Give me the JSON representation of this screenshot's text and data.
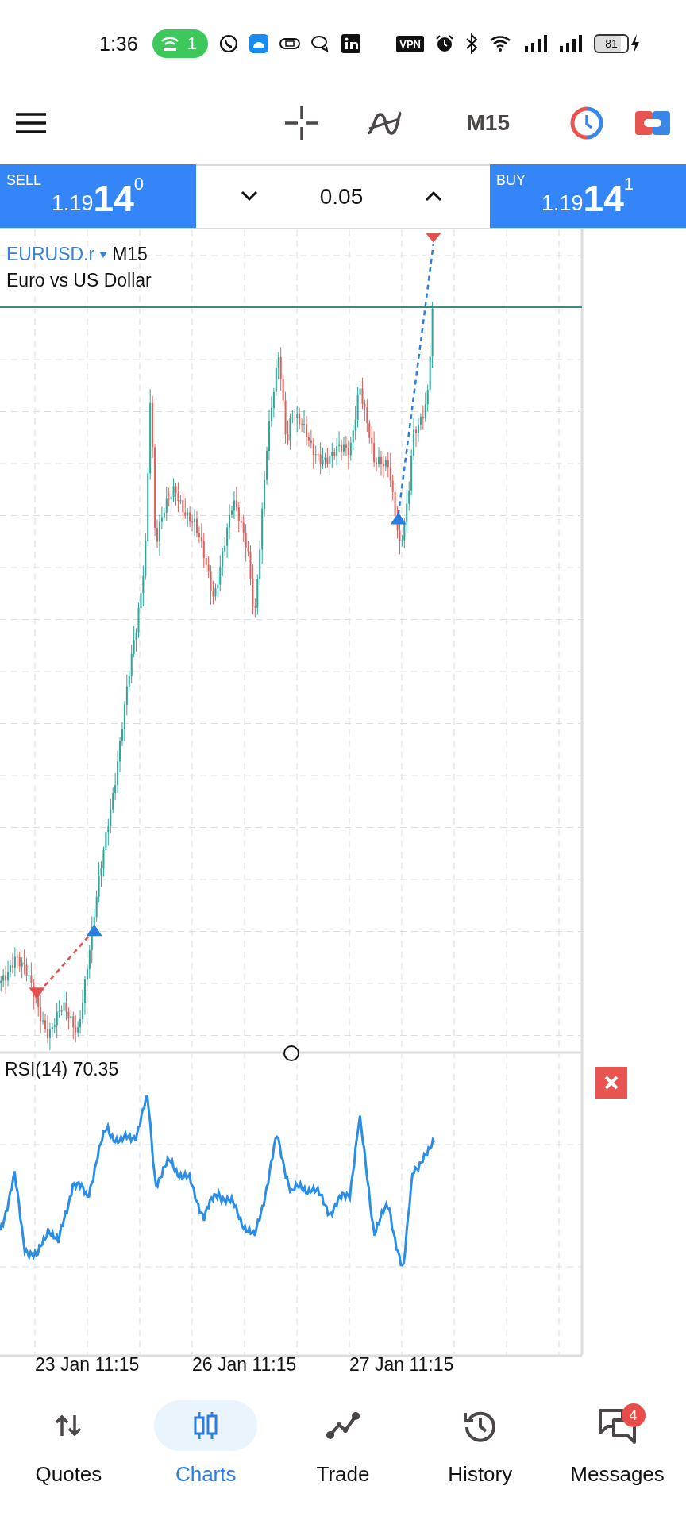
{
  "status_bar": {
    "time": "1:36",
    "hotspot_count": "1",
    "vpn_label": "VPN",
    "battery": "81"
  },
  "toolbar": {
    "timeframe": "M15"
  },
  "trade_panel": {
    "sell": {
      "label": "SELL",
      "price_small": "1.19",
      "price_big": "14",
      "price_sup": "0"
    },
    "volume": "0.05",
    "buy": {
      "label": "BUY",
      "price_small": "1.19",
      "price_big": "14",
      "price_sup": "1"
    }
  },
  "chart": {
    "symbol": "EURUSD.r",
    "timeframe": "M15",
    "description": "Euro vs US Dollar",
    "kind": "picture"
  },
  "indicator": {
    "label": "RSI(14) 70.35"
  },
  "time_axis": [
    "23 Jan 11:15",
    "26 Jan 11:15",
    "27 Jan 11:15"
  ],
  "nav": [
    {
      "label": "Quotes",
      "selected": false
    },
    {
      "label": "Charts",
      "selected": true
    },
    {
      "label": "Trade",
      "selected": false
    },
    {
      "label": "History",
      "selected": false
    },
    {
      "label": "Messages",
      "selected": false,
      "badge": "4"
    }
  ]
}
